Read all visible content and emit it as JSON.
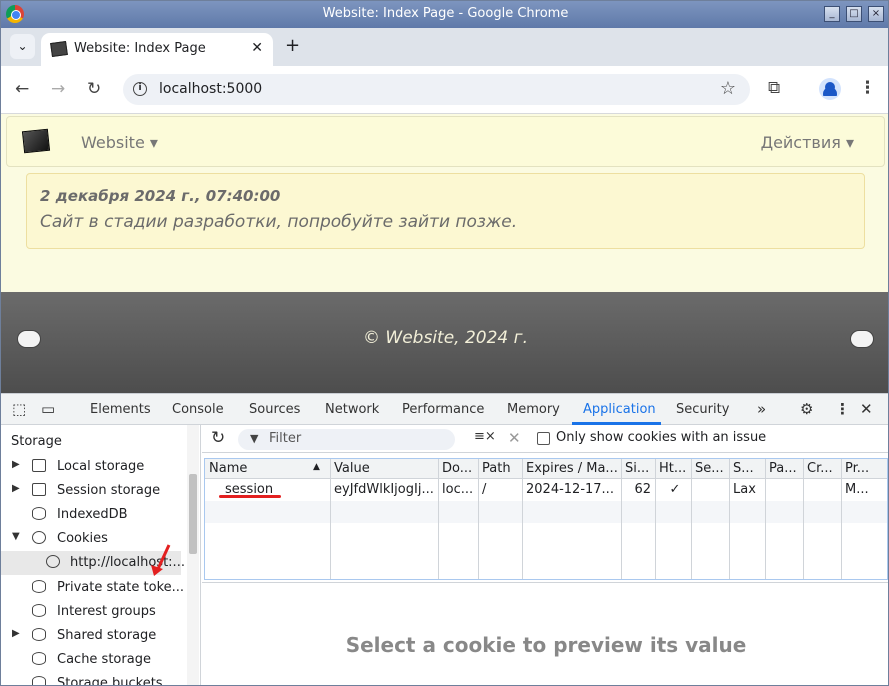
{
  "window": {
    "title": "Website: Index Page - Google Chrome"
  },
  "tab": {
    "title": "Website: Index Page"
  },
  "omnibox": {
    "url": "localhost:5000"
  },
  "site": {
    "brand": "Website ▾",
    "actions": "Действия ▾",
    "alert_date": "2 декабря 2024 г., 07:40:00",
    "alert_message": "Сайт в стадии разработки, попробуйте зайти позже.",
    "footer": "© Website, 2024 г."
  },
  "devtools": {
    "tabs": [
      "Elements",
      "Console",
      "Sources",
      "Network",
      "Performance",
      "Memory",
      "Application",
      "Security"
    ],
    "active_tab": "Application",
    "sidebar": {
      "title": "Storage",
      "items": [
        {
          "label": "Local storage"
        },
        {
          "label": "Session storage"
        },
        {
          "label": "IndexedDB"
        },
        {
          "label": "Cookies"
        },
        {
          "label": "http://localhost:..."
        },
        {
          "label": "Private state toke..."
        },
        {
          "label": "Interest groups"
        },
        {
          "label": "Shared storage"
        },
        {
          "label": "Cache storage"
        },
        {
          "label": "Storage buckets"
        }
      ]
    },
    "cookies": {
      "filter_placeholder": "Filter",
      "only_issues_label": "Only show cookies with an issue",
      "columns": [
        "Name",
        "Value",
        "Do...",
        "Path",
        "Expires / Ma...",
        "Si...",
        "Ht...",
        "Se...",
        "S...",
        "Pa...",
        "Cr...",
        "Pr..."
      ],
      "row": [
        "session",
        "eyJfdWlkIjogIj...",
        "loc...",
        "/",
        "2024-12-17...",
        "62",
        "✓",
        "",
        "Lax",
        "",
        "",
        "M..."
      ],
      "preview_text": "Select a cookie to preview its value"
    }
  }
}
